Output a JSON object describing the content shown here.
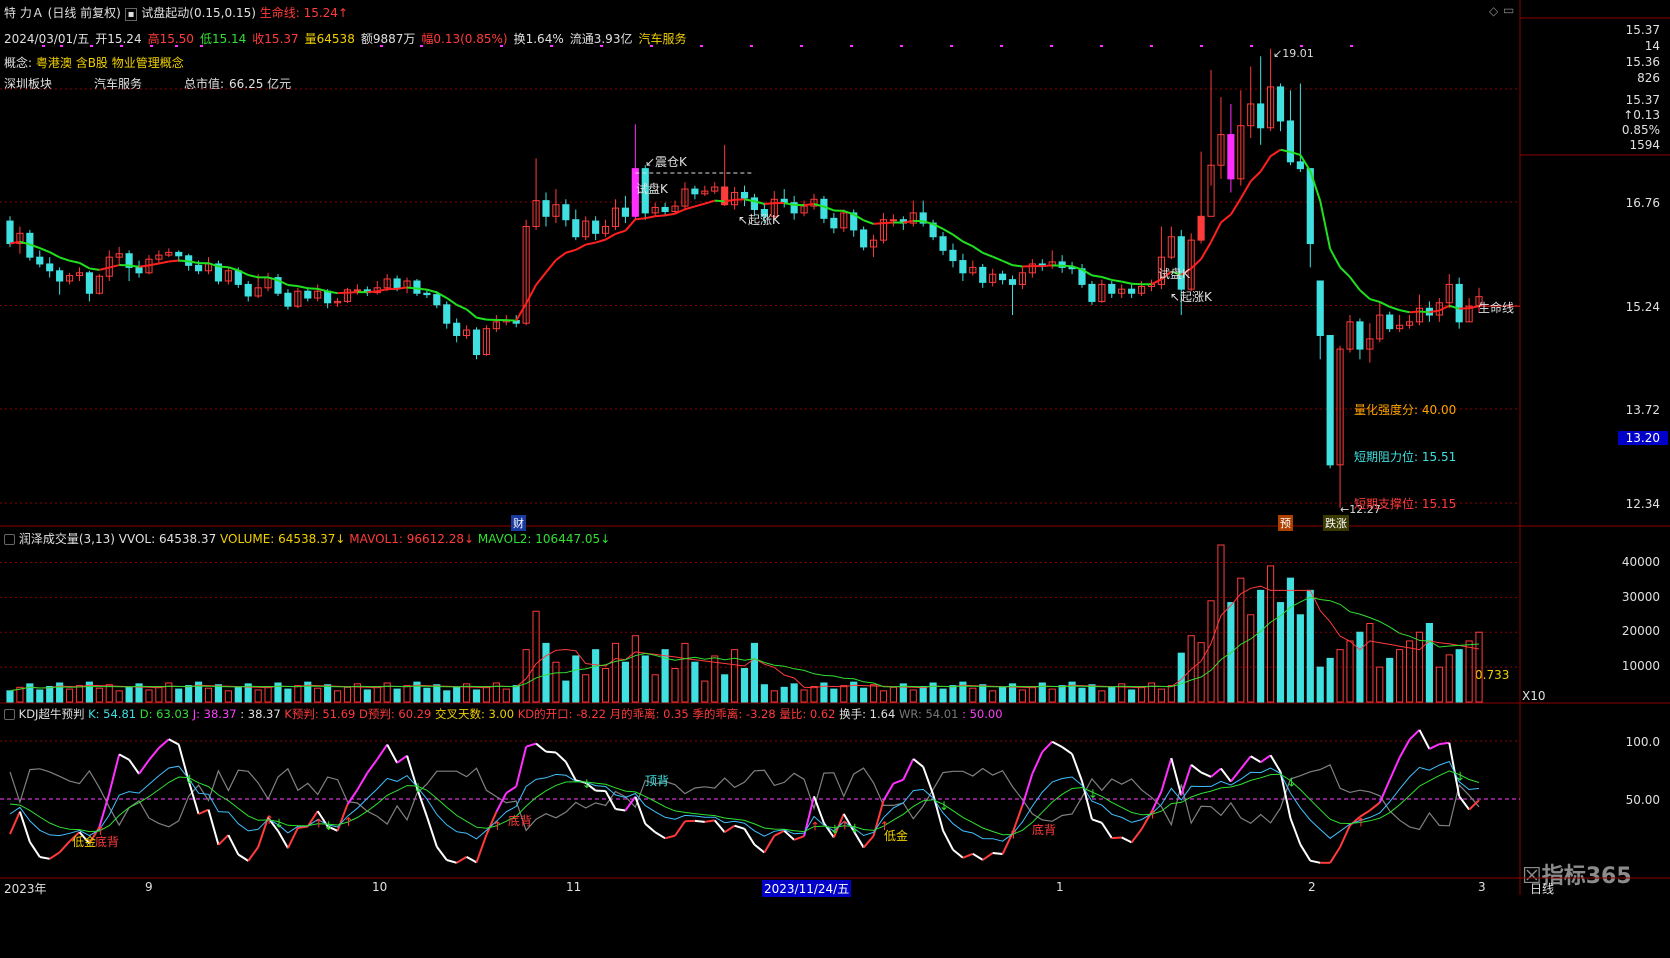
{
  "header": {
    "stock_name": "特 力Ａ",
    "period": "(日线 前复权)",
    "indicator": "试盘起动(0.15,0.15)",
    "lifeline": "生命线: 15.24",
    "lifeline_arrow": "↑",
    "quote": {
      "date": "2024/03/01/五",
      "open": "开15.24",
      "high": "高15.50",
      "low": "低15.14",
      "close": "收15.37",
      "vol": "量64538",
      "amount": "额9887万",
      "change": "幅0.13(0.85%)",
      "turnover": "换1.64%",
      "float": "流通3.93亿",
      "sector": "汽车服务"
    },
    "concept": "概念:",
    "concept_text": "粤港澳 含B股 物业管理概念",
    "board": "深圳板块",
    "industry": "汽车服务",
    "market_cap_label": "总市值:",
    "market_cap": "66.25 亿元"
  },
  "right_panel": {
    "v1": "15.37",
    "v2": "14",
    "v3": "15.36",
    "v4": "826",
    "v5": "15.37",
    "v6": "↑0.13",
    "v7": "0.85%",
    "v8": "1594"
  },
  "price_axis": [
    "16.76",
    "15.24",
    "13.72",
    "13.20",
    "12.34"
  ],
  "chart_annotations": {
    "max": "19.01",
    "min": "12.27",
    "shock": "↙震仓K",
    "trial1": "试盘K",
    "rise1": "↖起涨K",
    "trial2": "试盘K",
    "rise2": "↖起涨K",
    "lifeline_label": "生命线",
    "strength": "量化强度分:  40.00",
    "resistance": "短期阻力位:  15.51",
    "support": "短期支撑位:  15.15",
    "tag_cai": "财",
    "tag_yu": "预",
    "tag_diezhang": "跌涨"
  },
  "volume_header": {
    "title": "润泽成交量(3,13)",
    "vvol": "VVOL: 64538.37",
    "volume": "VOLUME: 64538.37",
    "mavol1": "MAVOL1: 96612.28",
    "mavol2": "MAVOL2: 106447.05",
    "last": "0.733",
    "unit": "X10"
  },
  "volume_axis": [
    "40000",
    "30000",
    "20000",
    "10000"
  ],
  "kdj_header": {
    "title": "KDJ超牛预判",
    "k": "K: 54.81",
    "d": "D: 63.03",
    "j": "J: 38.37",
    "x": ": 38.37",
    "kpre": "K预判: 51.69",
    "dpre": "D预判: 60.29",
    "cross": "交叉天数: 3.00",
    "kdopen": "KD的开口: -8.22",
    "month": "月的乖离: 0.35",
    "season": "季的乖离: -3.28",
    "vr": "量比: 0.62",
    "turn": "换手: 1.64",
    "wr": "WR: 54.01",
    "fifty": ": 50.00"
  },
  "kdj_axis": [
    "100.0",
    "50.00"
  ],
  "kdj_labels": {
    "low_gold1": "低金",
    "bottom_div1": "底背",
    "bottom_div2": "底背",
    "top_div": "顶背",
    "low_gold2": "低金",
    "bottom_div3": "底背"
  },
  "time_axis": {
    "labels": [
      "2023年",
      "9",
      "10",
      "11",
      "2023/11/24/五",
      "1",
      "2",
      "3"
    ],
    "period": "日线"
  },
  "watermark": "指标365",
  "colors": {
    "up": "#ff3b3b",
    "down": "#40e0e0",
    "lifeline_up": "#ff2020",
    "lifeline_down": "#20e020",
    "trial": "#ff30ff",
    "grid": "#8a0000"
  },
  "chart_data": {
    "type": "candlestick",
    "candles": [
      [
        16.48,
        16.15,
        16.55,
        16.1
      ],
      [
        16.15,
        16.3,
        16.4,
        16.0
      ],
      [
        16.3,
        15.95,
        16.35,
        15.9
      ],
      [
        15.95,
        15.85,
        16.05,
        15.8
      ],
      [
        15.85,
        15.75,
        15.95,
        15.65
      ],
      [
        15.75,
        15.6,
        15.8,
        15.4
      ],
      [
        15.6,
        15.68,
        15.72,
        15.55
      ],
      [
        15.68,
        15.72,
        15.8,
        15.6
      ],
      [
        15.72,
        15.42,
        15.75,
        15.3
      ],
      [
        15.42,
        15.67,
        15.7,
        15.4
      ],
      [
        15.67,
        15.95,
        16.05,
        15.6
      ],
      [
        15.95,
        16.0,
        16.1,
        15.85
      ],
      [
        16.0,
        15.8,
        16.05,
        15.6
      ],
      [
        15.8,
        15.72,
        15.9,
        15.65
      ],
      [
        15.72,
        15.92,
        15.98,
        15.7
      ],
      [
        15.92,
        15.98,
        16.05,
        15.85
      ],
      [
        15.98,
        16.02,
        16.08,
        15.95
      ],
      [
        16.02,
        15.97,
        16.05,
        15.88
      ],
      [
        15.97,
        15.83,
        16.0,
        15.75
      ],
      [
        15.83,
        15.75,
        15.9,
        15.7
      ],
      [
        15.75,
        15.85,
        15.95,
        15.7
      ],
      [
        15.85,
        15.6,
        15.9,
        15.55
      ],
      [
        15.6,
        15.75,
        15.8,
        15.55
      ],
      [
        15.75,
        15.55,
        15.8,
        15.5
      ],
      [
        15.55,
        15.38,
        15.6,
        15.3
      ],
      [
        15.38,
        15.5,
        15.7,
        15.35
      ],
      [
        15.5,
        15.65,
        15.72,
        15.45
      ],
      [
        15.65,
        15.42,
        15.7,
        15.38
      ],
      [
        15.42,
        15.23,
        15.48,
        15.18
      ],
      [
        15.23,
        15.45,
        15.5,
        15.2
      ],
      [
        15.45,
        15.35,
        15.5,
        15.3
      ],
      [
        15.35,
        15.45,
        15.55,
        15.3
      ],
      [
        15.45,
        15.28,
        15.48,
        15.2
      ],
      [
        15.28,
        15.3,
        15.35,
        15.22
      ],
      [
        15.3,
        15.47,
        15.5,
        15.28
      ],
      [
        15.47,
        15.47,
        15.55,
        15.4
      ],
      [
        15.47,
        15.43,
        15.52,
        15.38
      ],
      [
        15.43,
        15.5,
        15.6,
        15.4
      ],
      [
        15.5,
        15.63,
        15.7,
        15.45
      ],
      [
        15.63,
        15.5,
        15.68,
        15.45
      ],
      [
        15.5,
        15.6,
        15.65,
        15.42
      ],
      [
        15.6,
        15.42,
        15.63,
        15.38
      ],
      [
        15.42,
        15.4,
        15.48,
        15.35
      ],
      [
        15.4,
        15.25,
        15.45,
        15.2
      ],
      [
        15.25,
        14.98,
        15.3,
        14.9
      ],
      [
        14.98,
        14.8,
        15.05,
        14.7
      ],
      [
        14.8,
        14.88,
        14.95,
        14.75
      ],
      [
        14.88,
        14.52,
        14.92,
        14.45
      ],
      [
        14.52,
        14.9,
        14.95,
        14.5
      ],
      [
        14.9,
        15.0,
        15.1,
        14.85
      ],
      [
        15.0,
        15.02,
        15.1,
        14.95
      ],
      [
        15.02,
        14.98,
        15.1,
        14.92
      ],
      [
        14.98,
        16.4,
        16.5,
        14.95
      ],
      [
        16.4,
        16.78,
        17.4,
        16.35
      ],
      [
        16.78,
        16.55,
        16.9,
        16.4
      ],
      [
        16.55,
        16.72,
        16.95,
        16.45
      ],
      [
        16.72,
        16.5,
        16.8,
        16.4
      ],
      [
        16.5,
        16.25,
        16.65,
        16.2
      ],
      [
        16.25,
        16.48,
        16.55,
        16.2
      ],
      [
        16.48,
        16.3,
        16.55,
        16.2
      ],
      [
        16.3,
        16.4,
        16.5,
        16.25
      ],
      [
        16.4,
        16.67,
        16.8,
        16.35
      ],
      [
        16.67,
        16.55,
        16.85,
        16.45
      ],
      [
        16.55,
        17.25,
        17.9,
        16.5
      ],
      [
        17.25,
        16.6,
        17.3,
        16.5
      ],
      [
        16.6,
        16.68,
        16.75,
        16.55
      ],
      [
        16.68,
        16.62,
        16.75,
        16.55
      ],
      [
        16.62,
        16.7,
        16.78,
        16.58
      ],
      [
        16.7,
        16.95,
        17.05,
        16.65
      ],
      [
        16.95,
        16.88,
        17.0,
        16.8
      ],
      [
        16.88,
        16.92,
        17.0,
        16.85
      ],
      [
        16.92,
        16.98,
        17.05,
        16.88
      ],
      [
        16.98,
        16.72,
        17.6,
        16.7
      ],
      [
        16.72,
        16.9,
        16.98,
        16.65
      ],
      [
        16.9,
        16.82,
        17.0,
        16.7
      ],
      [
        16.82,
        16.65,
        16.88,
        16.55
      ],
      [
        16.65,
        16.55,
        16.75,
        16.45
      ],
      [
        16.55,
        16.8,
        16.92,
        16.5
      ],
      [
        16.8,
        16.75,
        16.95,
        16.68
      ],
      [
        16.75,
        16.6,
        16.85,
        16.5
      ],
      [
        16.6,
        16.7,
        16.78,
        16.55
      ],
      [
        16.7,
        16.8,
        16.88,
        16.65
      ],
      [
        16.8,
        16.52,
        16.85,
        16.45
      ],
      [
        16.52,
        16.38,
        16.6,
        16.3
      ],
      [
        16.38,
        16.6,
        16.65,
        16.32
      ],
      [
        16.6,
        16.35,
        16.65,
        16.25
      ],
      [
        16.35,
        16.1,
        16.4,
        16.05
      ],
      [
        16.1,
        16.2,
        16.28,
        15.95
      ],
      [
        16.2,
        16.5,
        16.6,
        16.15
      ],
      [
        16.5,
        16.5,
        16.58,
        16.4
      ],
      [
        16.5,
        16.45,
        16.55,
        16.35
      ],
      [
        16.45,
        16.6,
        16.78,
        16.4
      ],
      [
        16.6,
        16.45,
        16.78,
        16.4
      ],
      [
        16.45,
        16.25,
        16.5,
        16.2
      ],
      [
        16.25,
        16.05,
        16.32,
        15.98
      ],
      [
        16.05,
        15.9,
        16.15,
        15.8
      ],
      [
        15.9,
        15.72,
        16.0,
        15.6
      ],
      [
        15.72,
        15.8,
        15.9,
        15.68
      ],
      [
        15.8,
        15.58,
        15.85,
        15.5
      ],
      [
        15.58,
        15.7,
        15.78,
        15.52
      ],
      [
        15.7,
        15.62,
        15.75,
        15.55
      ],
      [
        15.62,
        15.55,
        15.68,
        15.1
      ],
      [
        15.55,
        15.72,
        15.8,
        15.48
      ],
      [
        15.72,
        15.85,
        15.92,
        15.65
      ],
      [
        15.85,
        15.82,
        15.92,
        15.75
      ],
      [
        15.82,
        15.88,
        16.05,
        15.78
      ],
      [
        15.88,
        15.8,
        15.98,
        15.72
      ],
      [
        15.8,
        15.78,
        15.88,
        15.7
      ],
      [
        15.78,
        15.55,
        15.85,
        15.5
      ],
      [
        15.55,
        15.3,
        15.6,
        15.25
      ],
      [
        15.3,
        15.55,
        15.62,
        15.28
      ],
      [
        15.55,
        15.42,
        15.6,
        15.35
      ],
      [
        15.42,
        15.48,
        15.55,
        15.35
      ],
      [
        15.48,
        15.42,
        15.55,
        15.35
      ],
      [
        15.42,
        15.52,
        15.6,
        15.38
      ],
      [
        15.52,
        15.55,
        15.62,
        15.45
      ],
      [
        15.55,
        15.95,
        16.4,
        15.48
      ],
      [
        15.95,
        16.25,
        16.4,
        15.92
      ],
      [
        16.25,
        15.48,
        16.35,
        15.1
      ],
      [
        15.48,
        16.2,
        16.3,
        15.45
      ],
      [
        16.2,
        16.55,
        17.5,
        16.15
      ],
      [
        16.55,
        17.3,
        18.7,
        17.0
      ],
      [
        17.3,
        17.75,
        18.3,
        17.1
      ],
      [
        17.75,
        17.1,
        18.2,
        16.9
      ],
      [
        17.1,
        17.88,
        18.4,
        17.0
      ],
      [
        17.88,
        18.2,
        18.75,
        17.7
      ],
      [
        18.2,
        17.85,
        18.9,
        17.6
      ],
      [
        17.85,
        18.45,
        19.01,
        17.8
      ],
      [
        18.45,
        17.95,
        18.5,
        17.8
      ],
      [
        17.95,
        17.35,
        18.4,
        17.3
      ],
      [
        17.35,
        17.25,
        18.5,
        17.2
      ],
      [
        17.25,
        16.15,
        16.2,
        15.8
      ],
      [
        15.6,
        14.8,
        15.6,
        14.45
      ],
      [
        14.8,
        12.9,
        13.95,
        12.85
      ],
      [
        12.9,
        14.6,
        14.65,
        12.27
      ],
      [
        14.6,
        15.0,
        15.1,
        14.55
      ],
      [
        15.0,
        14.6,
        15.05,
        14.45
      ],
      [
        14.6,
        14.75,
        14.98,
        14.4
      ],
      [
        14.75,
        15.1,
        15.3,
        14.7
      ],
      [
        15.1,
        14.9,
        15.15,
        14.85
      ],
      [
        14.9,
        14.95,
        15.1,
        14.85
      ],
      [
        14.95,
        15.0,
        15.1,
        14.9
      ],
      [
        15.0,
        15.2,
        15.4,
        14.95
      ],
      [
        15.2,
        15.1,
        15.3,
        15.0
      ],
      [
        15.1,
        15.28,
        15.35,
        15.0
      ],
      [
        15.28,
        15.55,
        15.7,
        15.2
      ],
      [
        15.55,
        15.0,
        15.65,
        14.9
      ],
      [
        15.0,
        15.23,
        15.35,
        15.0
      ],
      [
        15.24,
        15.37,
        15.5,
        15.14
      ]
    ]
  }
}
